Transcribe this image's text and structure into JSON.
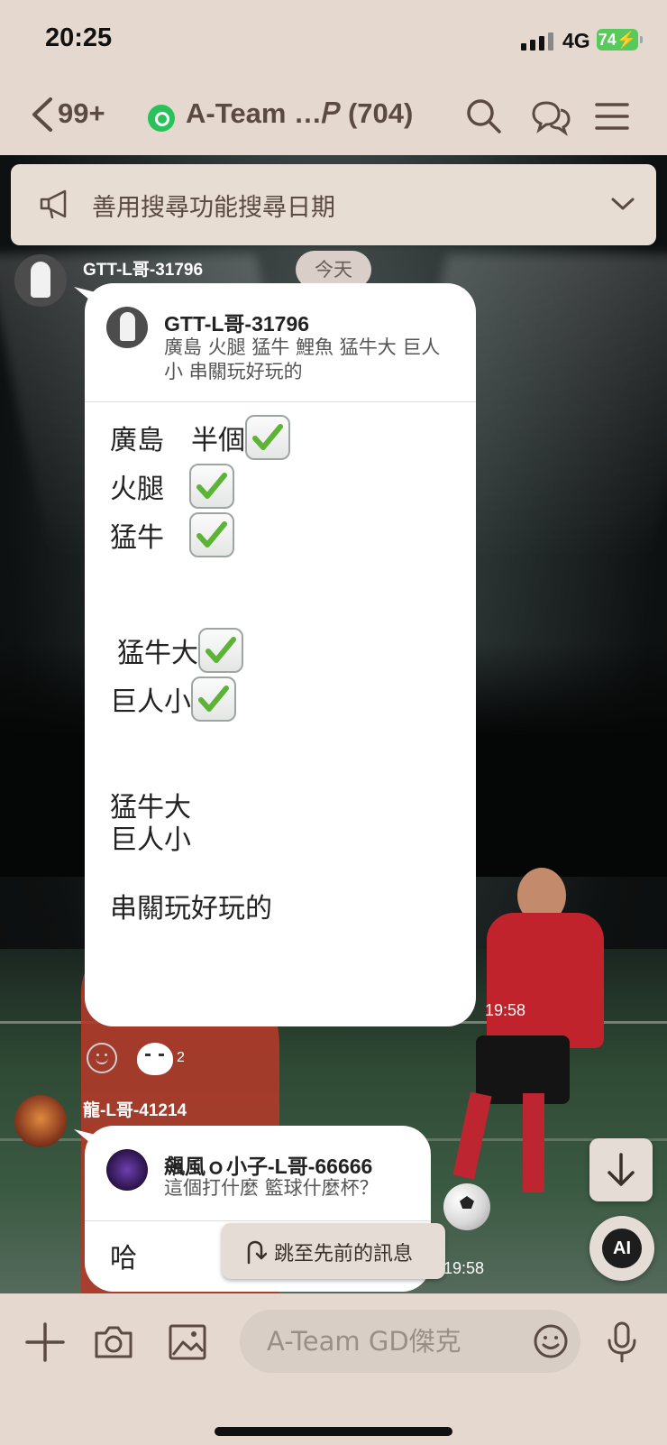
{
  "status_bar": {
    "time": "20:25",
    "network": "4G",
    "battery": "74"
  },
  "header": {
    "unread_count": "99+",
    "chat_title": "A-Team …𝑃 (704)",
    "icons": [
      "back-chevron-icon",
      "search-icon",
      "chat-bubbles-icon",
      "menu-icon"
    ]
  },
  "notice": {
    "text": "善用搜尋功能搜尋日期"
  },
  "date_divider": "今天",
  "messages": [
    {
      "sender": "GTT-L哥-31796",
      "quote": {
        "name": "GTT-L哥-31796",
        "text": "廣島 火腿 猛牛 鯉魚 猛牛大 巨人小 串關玩好玩的"
      },
      "lines": [
        "廣島　半個",
        "火腿",
        "猛牛",
        "猛牛大",
        "巨人小",
        "猛牛大",
        "巨人小",
        "串關玩好玩的"
      ],
      "time": "19:58",
      "reaction_count": "2"
    },
    {
      "sender": "龍-L哥-41214",
      "quote": {
        "name": "飆風ｏ小子-L哥-66666",
        "text": "這個打什麼 籃球什麼杯？"
      },
      "text": "哈",
      "time": "19:58"
    }
  ],
  "jump_pill": {
    "label": "跳至先前的訊息"
  },
  "ai_button": {
    "label": "AI"
  },
  "input": {
    "placeholder": "A-Team GD傑克"
  },
  "colors": {
    "background": "#e5d9cf",
    "bubble": "#ffffff",
    "check_green": "#5cb335",
    "battery_green": "#58c95b"
  }
}
